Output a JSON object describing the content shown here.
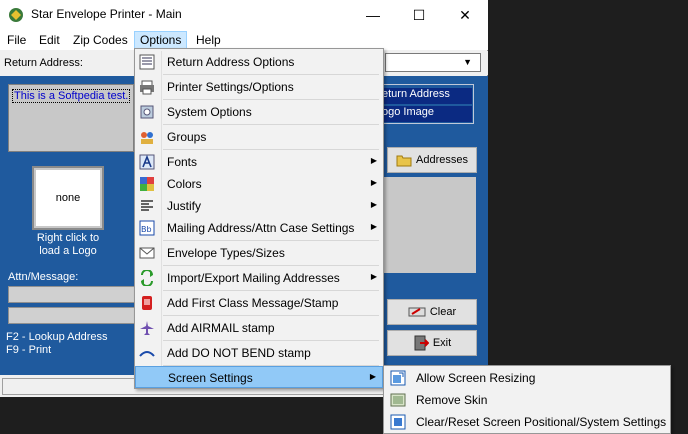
{
  "window": {
    "title": "Star Envelope Printer - Main",
    "minimize": "—",
    "maximize": "☐",
    "close": "✕"
  },
  "menubar": [
    {
      "label": "File"
    },
    {
      "label": "Edit"
    },
    {
      "label": "Zip Codes"
    },
    {
      "label": "Options"
    },
    {
      "label": "Help"
    }
  ],
  "return_address": {
    "label": "Return Address:",
    "text": "This is a Softpedia test.",
    "dropdown_arrow": "▼"
  },
  "options_panel": {
    "row1": "eturn Address",
    "row2": "ogo Image"
  },
  "logo": {
    "value": "none",
    "hint": "Right click to load a Logo"
  },
  "attn": {
    "label": "Attn/Message:"
  },
  "fkeys": {
    "f2": "F2 - Lookup Address",
    "f9": "F9 - Print"
  },
  "buttons": {
    "addresses": "Addresses",
    "clear": "Clear",
    "exit": "Exit"
  },
  "options_menu": {
    "items": [
      {
        "label": "Return Address Options",
        "icon": "return-address-icon"
      },
      {
        "label": "Printer Settings/Options",
        "icon": "printer-icon"
      },
      {
        "label": "System Options",
        "icon": "system-options-icon"
      },
      {
        "label": "Groups",
        "icon": "groups-icon"
      },
      {
        "label": "Fonts",
        "icon": "fonts-icon"
      },
      {
        "label": "Colors",
        "icon": "colors-icon"
      },
      {
        "label": "Justify",
        "icon": "justify-icon"
      },
      {
        "label": "Mailing Address/Attn Case Settings",
        "icon": "case-settings-icon"
      },
      {
        "label": "Envelope Types/Sizes",
        "icon": "envelope-icon"
      },
      {
        "label": "Import/Export Mailing Addresses",
        "icon": "import-export-icon"
      },
      {
        "label": "Add First Class Message/Stamp",
        "icon": "stamp-icon"
      },
      {
        "label": "Add AIRMAIL stamp",
        "icon": "airmail-icon"
      },
      {
        "label": "Add DO NOT BEND stamp",
        "icon": "do-not-bend-icon"
      },
      {
        "label": "Screen Settings",
        "icon": ""
      }
    ],
    "submenu_arrow": "▶"
  },
  "screen_settings_menu": {
    "items": [
      {
        "label": "Allow Screen Resizing",
        "icon": "resize-icon"
      },
      {
        "label": "Remove Skin",
        "icon": "skin-icon"
      },
      {
        "label": "Clear/Reset Screen Positional/System Settings",
        "icon": "reset-icon"
      }
    ]
  },
  "colors": {
    "panel_blue": "#1f5a9e",
    "highlight": "#91c9f7",
    "option_row": "#0b2a82"
  }
}
